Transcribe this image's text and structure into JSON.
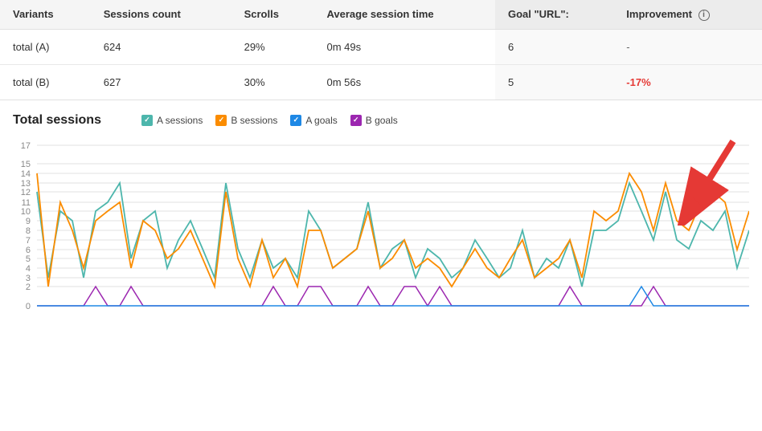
{
  "table": {
    "headers": [
      "Variants",
      "Sessions count",
      "Scrolls",
      "Average session time",
      "Goal \"URL\":",
      "Improvement"
    ],
    "rows": [
      {
        "variant": "total (A)",
        "sessions": "624",
        "scrolls": "29%",
        "avg_time": "0m 49s",
        "goal": "6",
        "improvement": "-",
        "improvement_type": "dash"
      },
      {
        "variant": "total (B)",
        "sessions": "627",
        "scrolls": "30%",
        "avg_time": "0m 56s",
        "goal": "5",
        "improvement": "-17%",
        "improvement_type": "negative"
      }
    ]
  },
  "chart": {
    "title": "Total sessions",
    "legend": [
      {
        "label": "A sessions",
        "color": "teal"
      },
      {
        "label": "B sessions",
        "color": "orange"
      },
      {
        "label": "A goals",
        "color": "blue"
      },
      {
        "label": "B goals",
        "color": "purple"
      }
    ],
    "y_labels": [
      "0",
      "2",
      "3",
      "4",
      "5",
      "6",
      "7",
      "8",
      "9",
      "10",
      "11",
      "12",
      "13",
      "14",
      "15",
      "17"
    ],
    "info_icon_label": "i"
  }
}
